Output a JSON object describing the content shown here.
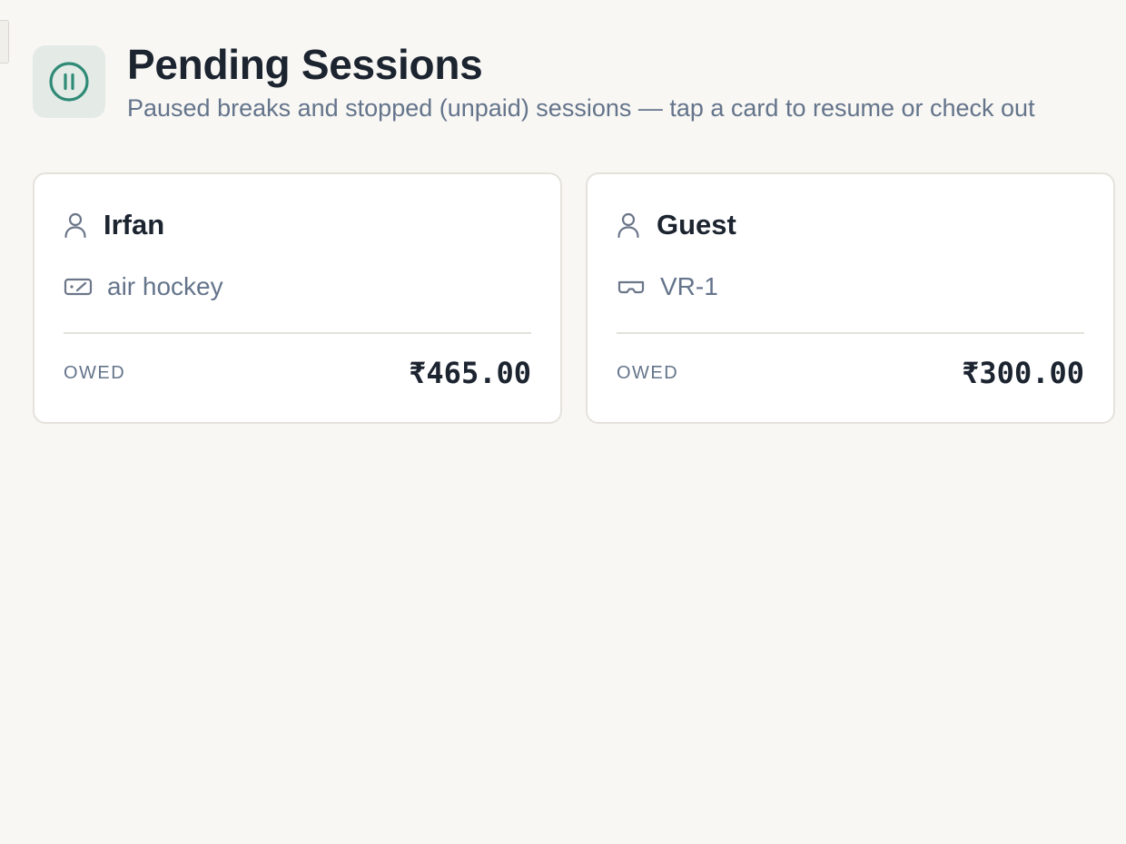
{
  "header": {
    "title": "Pending Sessions",
    "subtitle": "Paused breaks and stopped (unpaid) sessions — tap a card to resume or check out",
    "icon": "pause-circle-icon",
    "accent_color": "#2f8a76"
  },
  "cards": [
    {
      "customer": "Irfan",
      "customer_icon": "user-icon",
      "station": "air hockey",
      "station_icon": "ticket-icon",
      "owed_label": "OWED",
      "owed_amount": "₹465.00"
    },
    {
      "customer": "Guest",
      "customer_icon": "user-icon",
      "station": "VR-1",
      "station_icon": "vr-headset-icon",
      "owed_label": "OWED",
      "owed_amount": "₹300.00"
    }
  ]
}
